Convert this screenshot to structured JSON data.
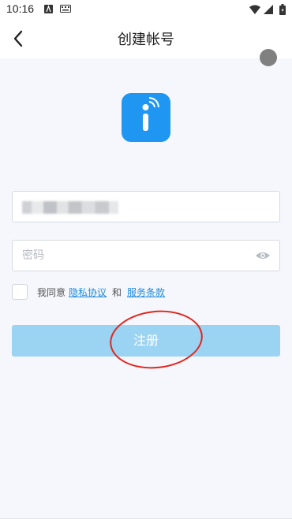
{
  "status_bar": {
    "time": "10:16"
  },
  "header": {
    "title": "创建帐号"
  },
  "form": {
    "password_placeholder": "密码"
  },
  "agreement": {
    "prefix": "我同意",
    "privacy_link": "隐私协议",
    "conjunction": "和",
    "terms_link": "服务条款"
  },
  "register_button": {
    "label": "注册"
  },
  "colors": {
    "accent": "#1f97f2",
    "button_disabled": "#9bd3f3",
    "annotation": "#e2261c",
    "link": "#1d8bdc"
  },
  "icons": [
    "back-arrow-icon",
    "wifi-icon",
    "signal-icon",
    "battery-icon",
    "app-logo-icon",
    "eye-icon"
  ]
}
